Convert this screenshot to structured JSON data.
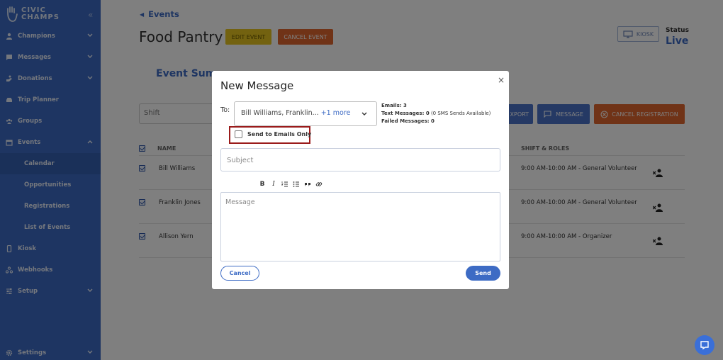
{
  "sidebar": {
    "logo_line1": "CIVIC",
    "logo_line2": "CHAMPS",
    "items": [
      {
        "label": "Champions",
        "icon": "person-icon"
      },
      {
        "label": "Messages",
        "icon": "message-icon"
      },
      {
        "label": "Donations",
        "icon": "donation-icon"
      },
      {
        "label": "Trip Planner",
        "icon": "car-icon"
      },
      {
        "label": "Groups",
        "icon": "groups-icon"
      },
      {
        "label": "Events",
        "icon": "calendar-icon"
      },
      {
        "label": "Kiosk",
        "icon": "tablet-icon"
      },
      {
        "label": "Webhooks",
        "icon": "webhook-icon"
      },
      {
        "label": "Setup",
        "icon": "sliders-icon"
      },
      {
        "label": "Settings",
        "icon": "gear-icon"
      }
    ],
    "events_sub": [
      "Calendar",
      "Opportunities",
      "Registrations",
      "List of Events"
    ],
    "active_sub": "Calendar"
  },
  "page": {
    "breadcrumb": "Events",
    "title": "Food Pantry",
    "edit_event": "EDIT EVENT",
    "cancel_event": "CANCEL EVENT",
    "kiosk": "KIOSK",
    "status_label": "Status",
    "status_value": "Live",
    "tab_summary": "Event Sum",
    "shift_placeholder": "Shift",
    "export": "XPORT",
    "message": "MESSAGE",
    "cancel_registration": "CANCEL REGISTRATION",
    "columns": {
      "name": "NAME",
      "shift": "SHIFT & ROLES"
    },
    "rows": [
      {
        "name": "Bill Williams",
        "shift": "9:00 AM-10:00 AM - General Volunteer"
      },
      {
        "name": "Franklin Jones",
        "shift": "9:00 AM-10:00 AM - General Volunteer"
      },
      {
        "name": "Allison Yern",
        "shift": "9:00 AM-10:00 AM - Organizer"
      }
    ]
  },
  "modal": {
    "title": "New Message",
    "close": "×",
    "to_label": "To:",
    "to_value": "Bill Williams, Franklin...",
    "to_more": "+1 more",
    "emails": "Emails: 3",
    "text_messages": "Text Messages: 0",
    "sms_note": "(0 SMS Sends Available)",
    "failed": "Failed Messages: 0",
    "emails_only_label": "Send to Emails Only",
    "emails_only_checked": false,
    "subject_placeholder": "Subject",
    "message_placeholder": "Message",
    "toolbar": {
      "bold": "B",
      "italic": "I"
    },
    "cancel": "Cancel",
    "send": "Send"
  },
  "colors": {
    "sidebar": "#3d6bc4",
    "accent": "#3d6bc4",
    "danger": "#e0662f",
    "warning": "#e7c420",
    "highlight": "#9a1b1b"
  }
}
